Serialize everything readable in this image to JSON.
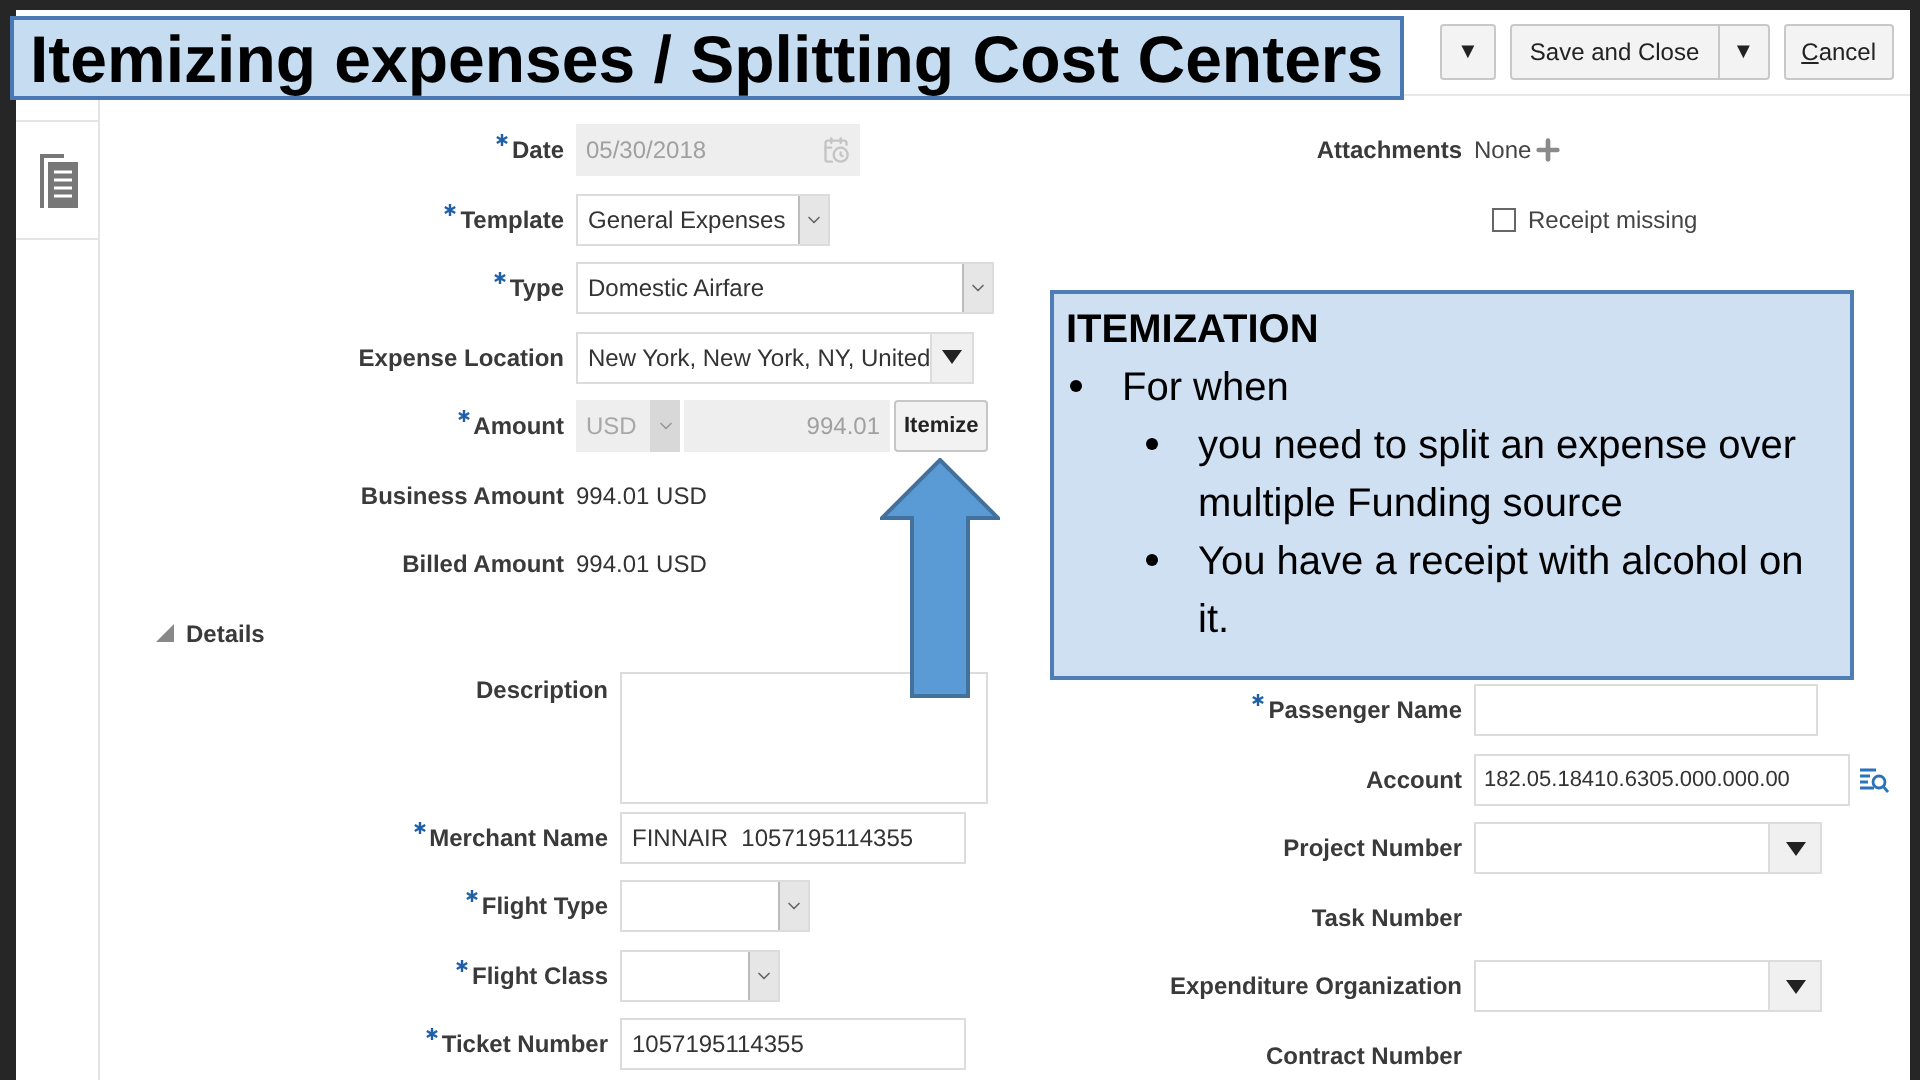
{
  "slide_title": "Itemizing expenses / Splitting Cost Centers",
  "toolbar": [
    {
      "kind": "menu",
      "label": "▼"
    },
    {
      "kind": "split",
      "label": "Save and Close",
      "menu": "▼"
    },
    {
      "kind": "button",
      "label": "Cancel",
      "underline_first": true
    }
  ],
  "main_fields": [
    {
      "kind": "date",
      "label": "Date",
      "required": true,
      "value": "05/30/2018"
    },
    {
      "kind": "select",
      "label": "Template",
      "required": true,
      "value": "General Expenses"
    },
    {
      "kind": "select",
      "label": "Type",
      "required": true,
      "value": "Domestic Airfare"
    },
    {
      "kind": "combo",
      "label": "Expense Location",
      "required": false,
      "value": "New York, New York, NY, United"
    },
    {
      "kind": "amount",
      "label": "Amount",
      "required": true,
      "currency": "USD",
      "value": "994.01",
      "action": "Itemize"
    },
    {
      "kind": "display",
      "label": "Business Amount",
      "required": false,
      "value": "994.01 USD"
    },
    {
      "kind": "display",
      "label": "Billed Amount",
      "required": false,
      "value": "994.01 USD"
    }
  ],
  "side_fields": [
    {
      "kind": "attachments",
      "label": "Attachments",
      "value": "None"
    },
    {
      "kind": "checkbox",
      "label": "Receipt missing",
      "checked": false
    }
  ],
  "details": {
    "label": "Details",
    "expanded": true,
    "fields": [
      {
        "kind": "textarea",
        "label": "Description",
        "required": false
      },
      {
        "kind": "text",
        "label": "Merchant Name",
        "required": true,
        "value": "FINNAIR  1057195114355"
      },
      {
        "kind": "select",
        "label": "Flight Type",
        "required": true
      },
      {
        "kind": "select",
        "label": "Flight Class",
        "required": true
      },
      {
        "kind": "text",
        "label": "Ticket Number",
        "required": true,
        "value": "1057195114355"
      }
    ],
    "side_fields": [
      {
        "kind": "text",
        "label": "Passenger Name",
        "required": true
      },
      {
        "kind": "lookup",
        "label": "Account",
        "required": false,
        "value": "182.05.18410.6305.000.000.00"
      },
      {
        "kind": "combo",
        "label": "Project Number",
        "required": false
      },
      {
        "kind": "label",
        "label": "Task Number",
        "required": false
      },
      {
        "kind": "combo",
        "label": "Expenditure Organization",
        "required": false
      },
      {
        "kind": "label",
        "label": "Contract Number",
        "required": false
      }
    ]
  },
  "callout": {
    "title": "ITEMIZATION",
    "items": [
      {
        "text": "For when",
        "children": [
          {
            "text": "you need to split an expense over multiple Funding source"
          },
          {
            "text": "You have a receipt with alcohol on it."
          }
        ]
      }
    ]
  }
}
